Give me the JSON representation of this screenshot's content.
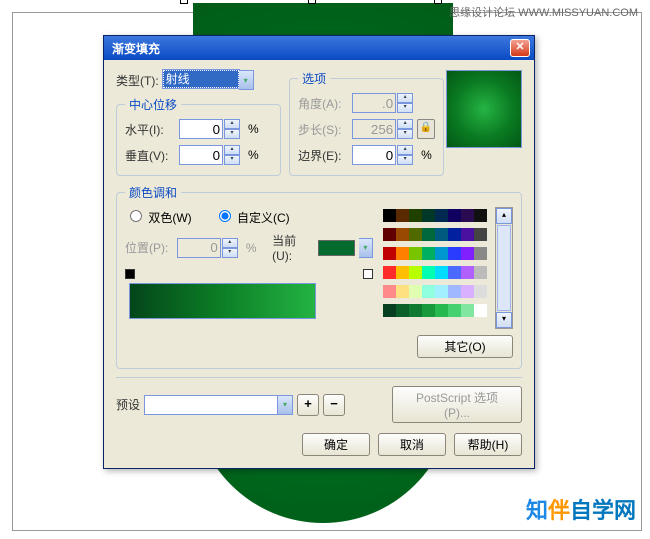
{
  "header_text": "思缘设计论坛  WWW.MISSYUAN.COM",
  "watermark": {
    "a": "知",
    "b": "伴",
    "c": "自学网"
  },
  "dialog": {
    "title": "渐变填充",
    "type_label": "类型(T):",
    "type_value": "射线",
    "center_offset": {
      "legend": "中心位移",
      "h_label": "水平(I):",
      "h_value": "0",
      "v_label": "垂直(V):",
      "v_value": "0",
      "pct": "%"
    },
    "options": {
      "legend": "选项",
      "angle_label": "角度(A):",
      "angle_value": ".0",
      "steps_label": "步长(S):",
      "steps_value": "256",
      "edge_label": "边界(E):",
      "edge_value": "0",
      "pct": "%"
    },
    "color_blend": {
      "legend": "颜色调和",
      "twocolor_label": "双色(W)",
      "custom_label": "自定义(C)",
      "pos_label": "位置(P):",
      "pos_value": "0",
      "pct": "%",
      "current_label": "当前(U):",
      "other_label": "其它(O)"
    },
    "preset_label": "预设",
    "postscript_label": "PostScript 选项(P)...",
    "ok": "确定",
    "cancel": "取消",
    "help": "帮助(H)"
  },
  "palette_colors": [
    "#000",
    "#5a2a00",
    "#204000",
    "#003828",
    "#002850",
    "#100060",
    "#2a0a50",
    "#111",
    "#600000",
    "#9a4a00",
    "#506a00",
    "#00683a",
    "#005a80",
    "#0020a0",
    "#4a10a0",
    "#444",
    "#c00000",
    "#ff7f00",
    "#79c400",
    "#00b060",
    "#0097d0",
    "#2a3cff",
    "#8020ff",
    "#888",
    "#ff2a2a",
    "#ffbf00",
    "#b8ff00",
    "#00ffb0",
    "#00dcff",
    "#4a6aff",
    "#b060ff",
    "#bbb",
    "#ff8a8a",
    "#ffe080",
    "#e0ffb0",
    "#90ffe0",
    "#a0f0ff",
    "#a0b8ff",
    "#d8b0ff",
    "#ddd",
    "#064020",
    "#0a6028",
    "#0f7a30",
    "#189a3c",
    "#28b850",
    "#46d070",
    "#80e6a0",
    "#fff"
  ]
}
